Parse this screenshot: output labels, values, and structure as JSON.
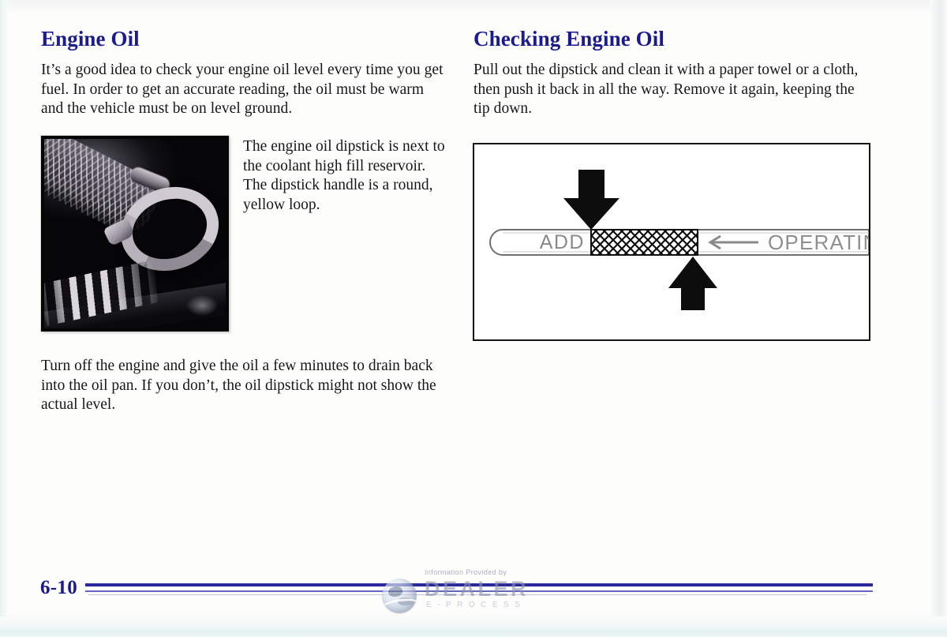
{
  "document": {
    "page_number": "6-10",
    "heading_color": "#1b1b8e",
    "body_color": "#17171a"
  },
  "left_column": {
    "heading": "Engine Oil",
    "intro_paragraph": "It’s a good idea to check your engine oil level every time you get fuel. In order to get an accurate reading, the oil must be warm and the vehicle must be on level ground.",
    "photo": {
      "alt": "Close-up photo of the engine oil dipstick handle, a round yellow loop, next to a braided hose",
      "name": "dipstick-handle-photo"
    },
    "photo_caption": "The engine oil dipstick is next to the coolant high fill reservoir. The dipstick handle is a round, yellow loop.",
    "closing_paragraph": "Turn off the engine and give the oil a few minutes to drain back into the oil pan. If you don’t, the oil dipstick might not show the actual level."
  },
  "right_column": {
    "heading": "Checking Engine Oil",
    "intro_paragraph": "Pull out the dipstick and clean it with a paper towel or a cloth, then push it back in all the way. Remove it again, keeping the tip down.",
    "figure": {
      "name": "dipstick-range-diagram",
      "add_label": "ADD",
      "operating_range_label": "OPERATING RANGE",
      "down_arrow_label": "down-arrow-marker",
      "up_arrow_label": "up-arrow-marker",
      "range_arrow_label": "left-arrow-pointer"
    }
  },
  "footer": {
    "page_number": "6-10",
    "watermark": {
      "line1": "Information Provided by",
      "brand": "DEALER",
      "tagline": "E-PROCESS"
    }
  }
}
